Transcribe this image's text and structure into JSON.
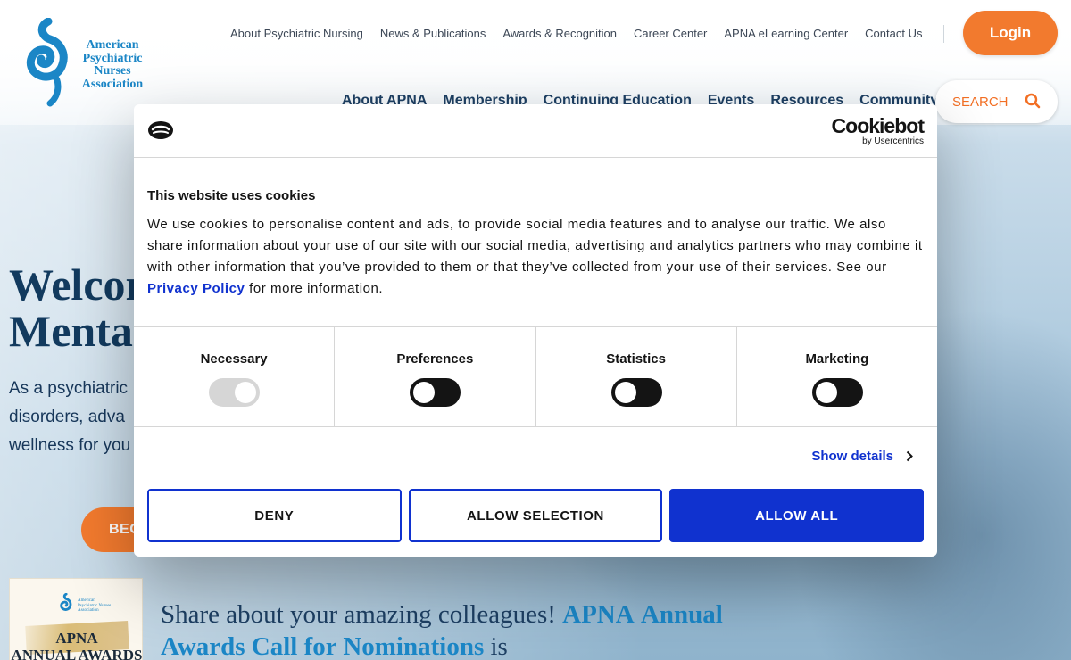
{
  "logo": {
    "line1": "American",
    "line2": "Psychiatric",
    "line3": "Nurses",
    "line4": "Association"
  },
  "util_nav": {
    "items": [
      "About Psychiatric Nursing",
      "News & Publications",
      "Awards & Recognition",
      "Career Center",
      "APNA eLearning Center",
      "Contact Us"
    ],
    "login_label": "Login"
  },
  "main_nav": {
    "items": [
      "About APNA",
      "Membership",
      "Continuing Education",
      "Events",
      "Resources",
      "Community"
    ],
    "search_label": "SEARCH"
  },
  "hero": {
    "title_line1": "Welcom",
    "title_line2": "Menta",
    "body_line1": "As a psychiatric",
    "body_line2": "disorders, adva",
    "body_line3": "wellness for you",
    "cta_label": "BEG"
  },
  "awards": {
    "card_org": "American Psychiatric Nurses Association",
    "card_title_line1": "APNA",
    "card_title_line2": "ANNUAL AWARDS",
    "share_text_1": "Share about your amazing colleagues!",
    "share_link_1": "APNA",
    "share_link_2": "Annual Awards Call for Nominations",
    "share_text_2": "is"
  },
  "cookie": {
    "brand": "Cookiebot",
    "brand_sub": "by Usercentrics",
    "title": "This website uses cookies",
    "text_before": "We use cookies to personalise content and ads, to provide social media features and to analyse our traffic. We also share information about your use of our site with our social media, advertising and analytics partners who may combine it with other information that you’ve provided to them or that they’ve collected from your use of their services. See our",
    "privacy_link": "Privacy Policy",
    "text_after": "for more information.",
    "toggles": [
      {
        "label": "Necessary",
        "enabled": true,
        "locked": true
      },
      {
        "label": "Preferences",
        "enabled": false,
        "locked": false
      },
      {
        "label": "Statistics",
        "enabled": false,
        "locked": false
      },
      {
        "label": "Marketing",
        "enabled": false,
        "locked": false
      }
    ],
    "show_details": "Show details",
    "deny_label": "DENY",
    "allow_selection_label": "ALLOW SELECTION",
    "allow_all_label": "ALLOW ALL"
  },
  "colors": {
    "brand_blue": "#1b86c6",
    "orange": "#f27a2e",
    "navy": "#1d3f63",
    "cookiebot_blue": "#1032cf"
  }
}
